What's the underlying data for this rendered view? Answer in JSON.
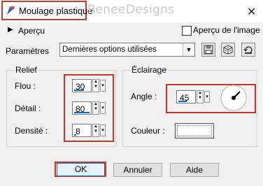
{
  "window": {
    "title": "Moulage plastique",
    "watermark": "ReneeDesigns",
    "close_glyph": "✕"
  },
  "preview": {
    "toggle_label": "Aperçu",
    "image_preview_label": "Aperçu de l'image",
    "image_preview_checked": false
  },
  "settings": {
    "label": "Paramètres",
    "selected": "Dernières options utilisées"
  },
  "toolbar_icons": [
    "save-preset-icon",
    "randomize-icon",
    "reset-icon"
  ],
  "relief": {
    "title": "Relief",
    "flou_label": "Flou :",
    "flou_value": "30",
    "detail_label": "Détail :",
    "detail_value": "80",
    "densite_label": "Densité :",
    "densite_value": "8"
  },
  "lighting": {
    "title": "Éclairage",
    "angle_label": "Angle :",
    "angle_value": "45",
    "color_label": "Couleur :",
    "color_value": "#ffffff"
  },
  "buttons": {
    "ok": "OK",
    "cancel": "Annuler",
    "help": "Aide"
  },
  "colors": {
    "highlight": "#c0392b",
    "accent": "#0078d7"
  }
}
